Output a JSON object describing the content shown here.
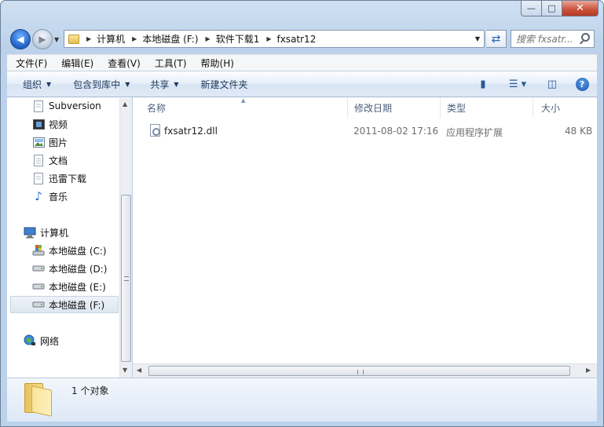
{
  "window": {
    "caption_minimize": "—",
    "caption_maximize": "□",
    "caption_close": "✕"
  },
  "address_bar": {
    "crumbs": [
      "计算机",
      "本地磁盘 (F:)",
      "软件下载1",
      "fxsatr12"
    ]
  },
  "search": {
    "placeholder": "搜索 fxsatr..."
  },
  "menu": {
    "items": [
      "文件(F)",
      "编辑(E)",
      "查看(V)",
      "工具(T)",
      "帮助(H)"
    ]
  },
  "command_bar": {
    "organize": "组织",
    "include_in_library": "包含到库中",
    "share": "共享",
    "new_folder": "新建文件夹"
  },
  "nav_pane": {
    "favorites": [
      {
        "label": "Subversion",
        "icon": "document-icon"
      },
      {
        "label": "视频",
        "icon": "video-icon"
      },
      {
        "label": "图片",
        "icon": "picture-icon"
      },
      {
        "label": "文档",
        "icon": "document-icon"
      },
      {
        "label": "迅雷下载",
        "icon": "document-icon"
      },
      {
        "label": "音乐",
        "icon": "music-icon"
      }
    ],
    "computer": "计算机",
    "drives": [
      {
        "label": "本地磁盘 (C:)",
        "icon": "system-drive-icon"
      },
      {
        "label": "本地磁盘 (D:)",
        "icon": "drive-icon"
      },
      {
        "label": "本地磁盘 (E:)",
        "icon": "drive-icon"
      },
      {
        "label": "本地磁盘 (F:)",
        "icon": "drive-icon",
        "selected": true
      }
    ],
    "network": "网络"
  },
  "file_list": {
    "columns": [
      "名称",
      "修改日期",
      "类型",
      "大小"
    ],
    "rows": [
      {
        "name": "fxsatr12.dll",
        "modified": "2011-08-02 17:16",
        "type": "应用程序扩展",
        "size": "48 KB",
        "icon": "dll-file-icon"
      }
    ]
  },
  "details_pane": {
    "count_text": "1 个对象"
  }
}
